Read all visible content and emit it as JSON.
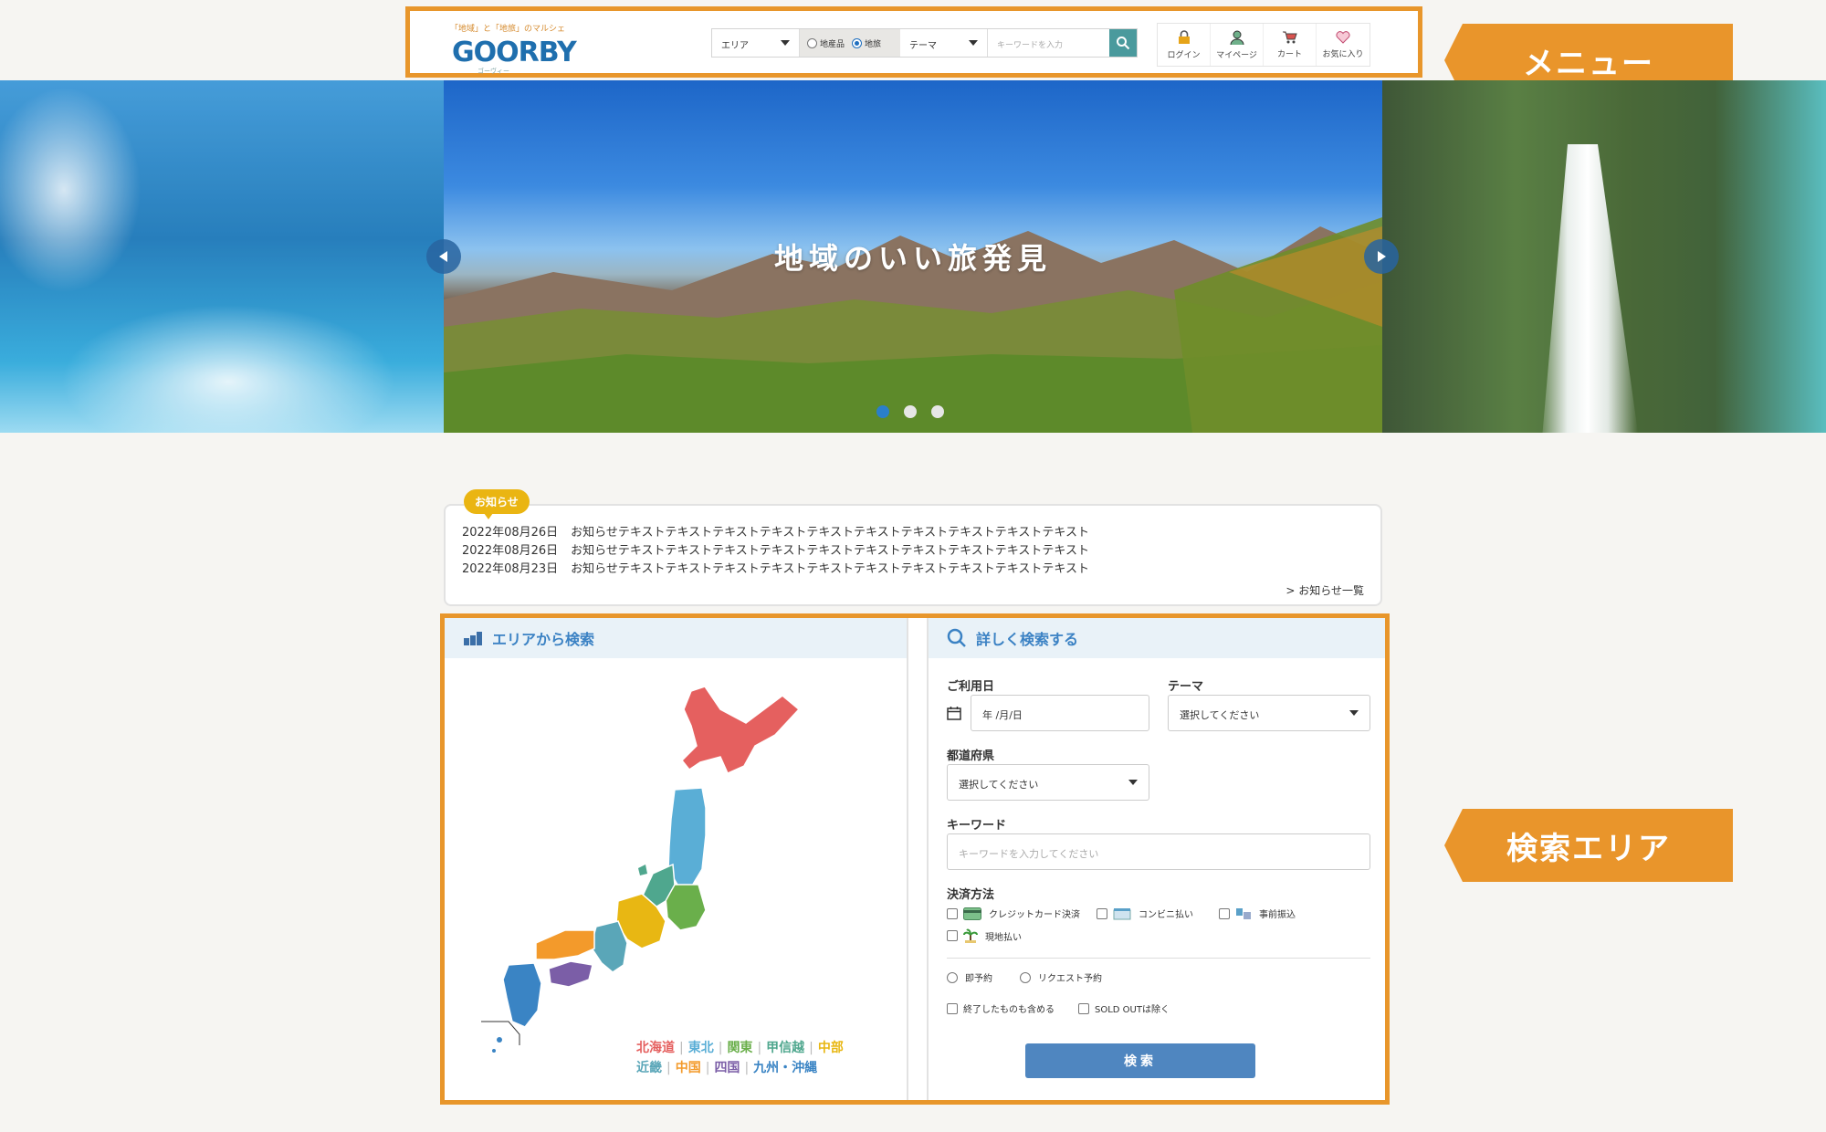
{
  "header": {
    "logo": {
      "tagline": "「地域」と「地旅」のマルシェ",
      "word": "GOORBY",
      "subtext": "ゴーヴィー"
    },
    "search": {
      "area_select": "エリア",
      "radio_products": "地産品",
      "radio_trips": "地旅",
      "theme_select": "テーマ",
      "keyword_placeholder": "キーワードを入力"
    },
    "nav": [
      {
        "label": "ログイン",
        "icon": "lock-icon"
      },
      {
        "label": "マイページ",
        "icon": "user-icon"
      },
      {
        "label": "カート",
        "icon": "cart-icon"
      },
      {
        "label": "お気に入り",
        "icon": "heart-icon"
      }
    ]
  },
  "annotations": {
    "menu": "メニュー",
    "search_area": "検索エリア"
  },
  "hero": {
    "title": "地域のいい旅発見",
    "slide_count": 3,
    "active_slide": 1
  },
  "news": {
    "badge": "お知らせ",
    "items": [
      {
        "date": "2022年08月26日",
        "text": "お知らせテキストテキストテキストテキストテキストテキストテキストテキストテキストテキスト"
      },
      {
        "date": "2022年08月26日",
        "text": "お知らせテキストテキストテキストテキストテキストテキストテキストテキストテキストテキスト"
      },
      {
        "date": "2022年08月23日",
        "text": "お知らせテキストテキストテキストテキストテキストテキストテキストテキストテキストテキスト"
      }
    ],
    "more": "> お知らせ一覧"
  },
  "area_search": {
    "title": "エリアから検索",
    "regions": [
      {
        "name": "北海道",
        "color": "#e5605f"
      },
      {
        "name": "東北",
        "color": "#5aaed6"
      },
      {
        "name": "関東",
        "color": "#6aaf4b"
      },
      {
        "name": "甲信越",
        "color": "#4fa78e"
      },
      {
        "name": "中部",
        "color": "#e8b713"
      },
      {
        "name": "近畿",
        "color": "#5aa6b8"
      },
      {
        "name": "中国",
        "color": "#f39a2b"
      },
      {
        "name": "四国",
        "color": "#7b5ea7"
      },
      {
        "name": "九州・沖縄",
        "color": "#3a84c4"
      }
    ]
  },
  "detail_search": {
    "title": "詳しく検索する",
    "date_label": "ご利用日",
    "date_placeholder": "年 /月/日",
    "theme_label": "テーマ",
    "theme_value": "選択してください",
    "pref_label": "都道府県",
    "pref_value": "選択してください",
    "keyword_label": "キーワード",
    "keyword_placeholder": "キーワードを入力してください",
    "payment_label": "決済方法",
    "payments": [
      "クレジットカード決済",
      "コンビニ払い",
      "事前振込",
      "現地払い"
    ],
    "booking": [
      "即予約",
      "リクエスト予約"
    ],
    "filters": [
      "終了したものも含める",
      "SOLD OUTは除く"
    ],
    "submit": "検索"
  }
}
